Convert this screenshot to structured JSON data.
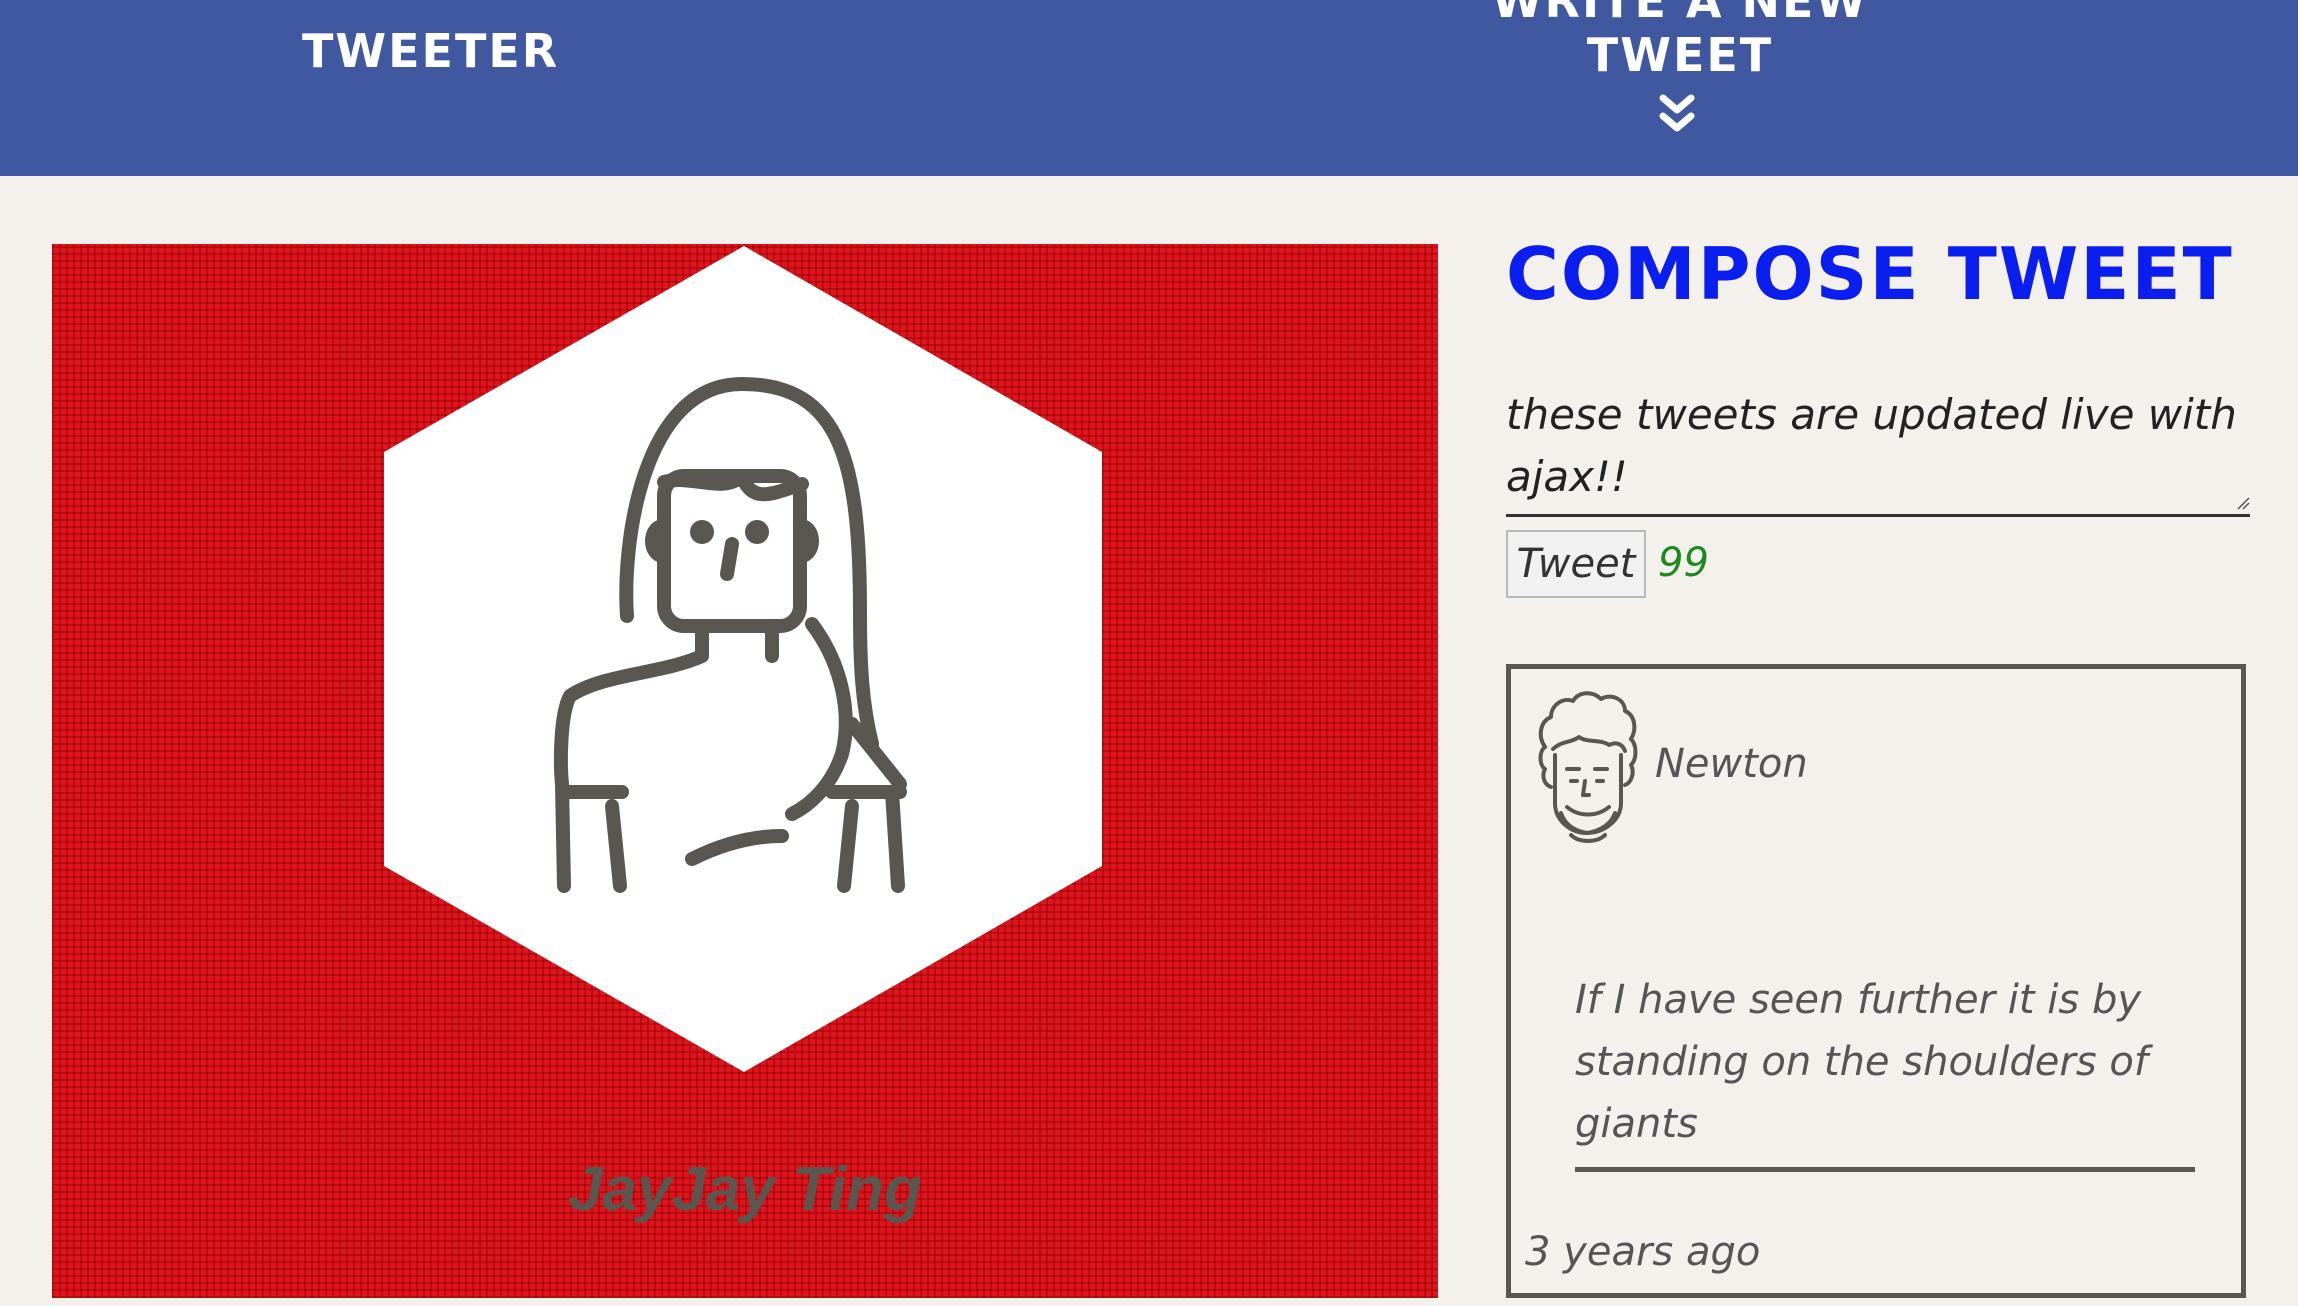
{
  "nav": {
    "brand": "Tweeter",
    "compose_link": "Write a new tweet",
    "toggle_icon": "double-chevron-down-icon"
  },
  "profile": {
    "name": "JayJay Ting",
    "avatar_icon": "woman-avatar-icon",
    "background_color": "#e0141c"
  },
  "compose": {
    "title": "Compose Tweet",
    "textarea_value": "these tweets are updated live with ajax!!",
    "button_label": "Tweet",
    "char_counter": "99"
  },
  "tweets": [
    {
      "author": "Newton",
      "avatar_icon": "curly-hair-man-avatar-icon",
      "body": "If I have seen further it is by standing on the shoulders of giants",
      "time": "3 years ago"
    }
  ],
  "colors": {
    "nav_background": "#4058a0",
    "page_background": "#f4f1ec",
    "accent_title": "#0b1ef0",
    "counter_ok": "#1c8a1c"
  }
}
